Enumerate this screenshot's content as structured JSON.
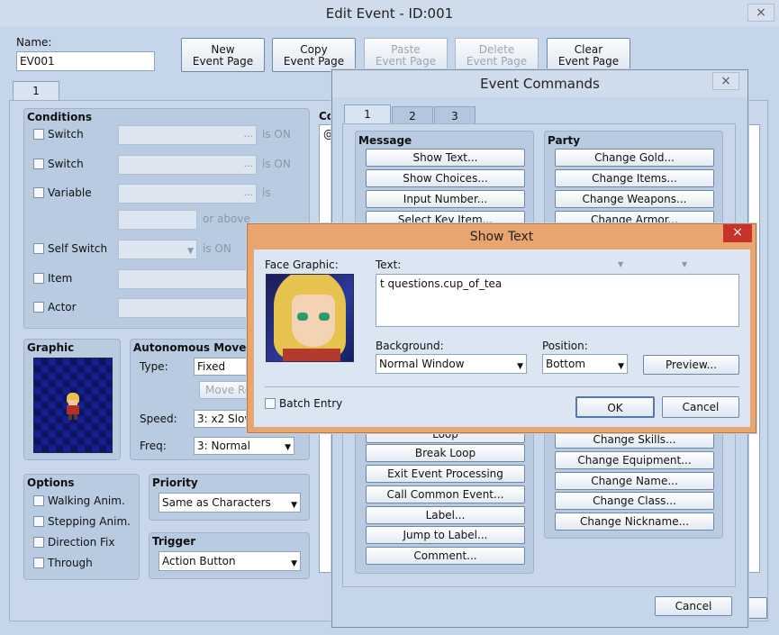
{
  "editEvent": {
    "title": "Edit Event - ID:001",
    "name_label": "Name:",
    "name_value": "EV001",
    "tab": "1",
    "buttons": {
      "new_page": "New\nEvent Page",
      "copy_page": "Copy\nEvent Page",
      "paste_page": "Paste\nEvent Page",
      "delete_page": "Delete\nEvent Page",
      "clear_page": "Clear\nEvent Page"
    },
    "conditions": {
      "title": "Conditions",
      "switch1": "Switch",
      "switch2": "Switch",
      "variable": "Variable",
      "self_switch": "Self Switch",
      "item": "Item",
      "actor": "Actor",
      "is_on": "is ON",
      "is": "is",
      "or_above": "or above",
      "more": "..."
    },
    "graphic": {
      "title": "Graphic"
    },
    "autonomous": {
      "title": "Autonomous Moven",
      "type_label": "Type:",
      "type_value": "Fixed",
      "move_route": "Move Ro",
      "speed_label": "Speed:",
      "speed_value": "3: x2 Slow",
      "freq_label": "Freq:",
      "freq_value": "3: Normal"
    },
    "options": {
      "title": "Options",
      "walking": "Walking Anim.",
      "stepping": "Stepping Anim.",
      "direction": "Direction Fix",
      "through": "Through"
    },
    "priority": {
      "title": "Priority",
      "value": "Same as Characters"
    },
    "trigger": {
      "title": "Trigger",
      "value": "Action Button"
    },
    "contents_label": "Co",
    "contents_first": "@"
  },
  "eventCommands": {
    "title": "Event Commands",
    "tabs": [
      "1",
      "2",
      "3"
    ],
    "message": {
      "title": "Message",
      "items": [
        "Show Text...",
        "Show Choices...",
        "Input Number...",
        "Select Key Item..."
      ]
    },
    "flow": {
      "items": [
        "Loop",
        "Break Loop",
        "Exit Event Processing",
        "Call Common Event...",
        "Label...",
        "Jump to Label...",
        "Comment..."
      ]
    },
    "party": {
      "title": "Party",
      "items": [
        "Change Gold...",
        "Change Items...",
        "Change Weapons...",
        "Change Armor..."
      ]
    },
    "actor": {
      "items": [
        "Change Skills...",
        "Change Equipment...",
        "Change Name...",
        "Change Class...",
        "Change Nickname..."
      ]
    },
    "cancel": "Cancel"
  },
  "showText": {
    "title": "Show Text",
    "face_label": "Face Graphic:",
    "text_label": "Text:",
    "text_value": "t questions.cup_of_tea",
    "background_label": "Background:",
    "background_value": "Normal Window",
    "position_label": "Position:",
    "position_value": "Bottom",
    "preview": "Preview...",
    "batch": "Batch Entry",
    "ok": "OK",
    "cancel": "Cancel"
  },
  "icons": {
    "close": "×",
    "dropdown": "▼"
  }
}
